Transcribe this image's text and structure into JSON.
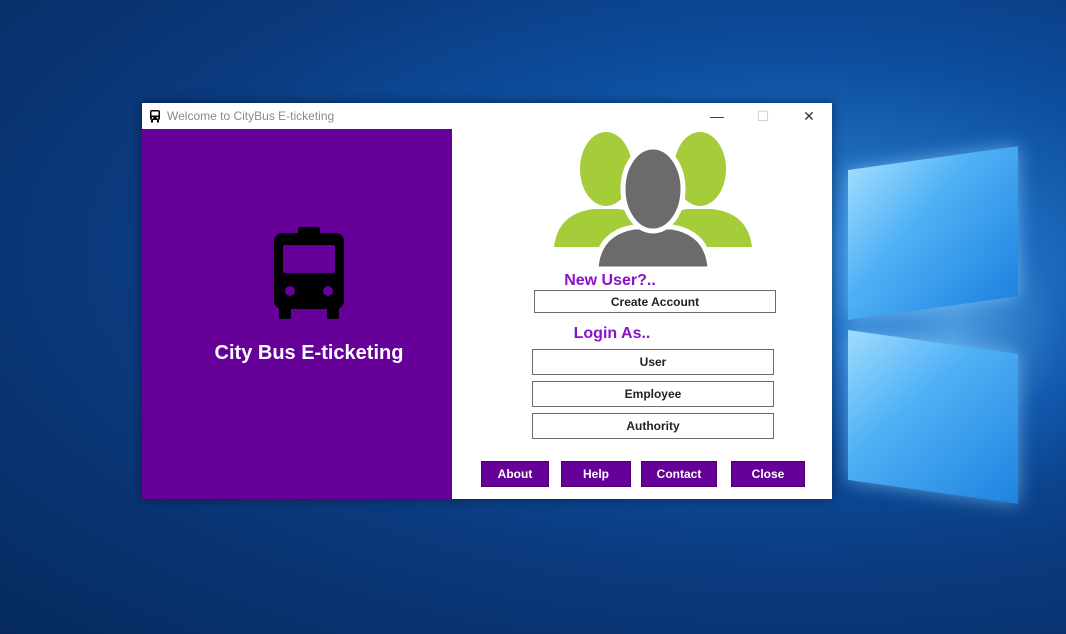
{
  "window": {
    "title": "Welcome to CityBus E-ticketing",
    "controls": {
      "minimize": "—",
      "maximize": "☐",
      "close": "✕"
    }
  },
  "left_panel": {
    "icon": "bus-icon",
    "app_title": "City Bus E-ticketing",
    "background": "#660099"
  },
  "right_panel": {
    "illustration": "users-group-icon",
    "new_user_label": "New User?..",
    "create_account_label": "Create Account",
    "login_as_label": "Login As..",
    "login_options": [
      "User",
      "Employee",
      "Authority"
    ],
    "footer_buttons": [
      "About",
      "Help",
      "Contact",
      "Close"
    ],
    "accent": "#8a11cc"
  },
  "colors": {
    "primary_purple": "#660099",
    "people_green": "#a5cc39",
    "person_gray": "#6b6b6b"
  }
}
